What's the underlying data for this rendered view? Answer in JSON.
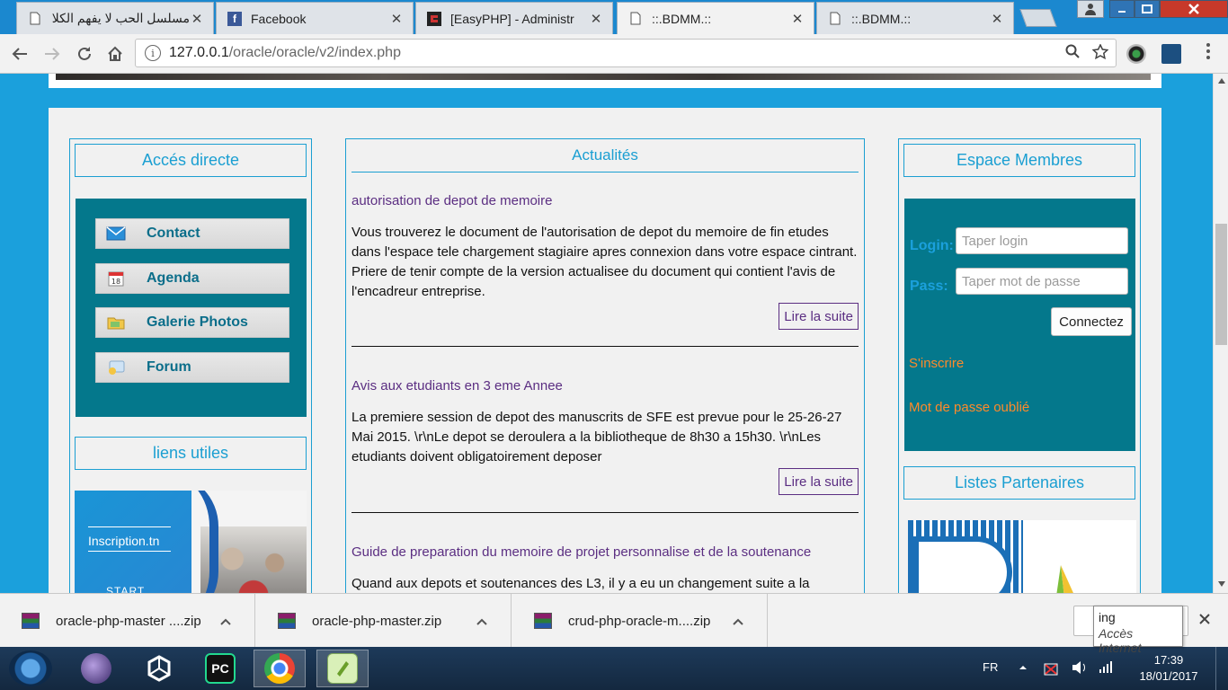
{
  "browser": {
    "tabs": [
      {
        "title": "مسلسل الحب لا يفهم الكلام ال",
        "icon": "page-icon",
        "active": false
      },
      {
        "title": "Facebook",
        "icon": "facebook-icon",
        "active": false
      },
      {
        "title": "[EasyPHP] - Administr",
        "icon": "easyphp-icon",
        "active": false
      },
      {
        "title": "::.BDMM.::",
        "icon": "page-icon",
        "active": true
      },
      {
        "title": "::.BDMM.::",
        "icon": "page-icon",
        "active": false
      }
    ],
    "close_glyph": "✕",
    "url_host": "127.0.0.1",
    "url_path": "/oracle/oracle/v2/index.php"
  },
  "left": {
    "title": "Accés directe",
    "menu": [
      {
        "label": "Contact",
        "icon": "envelope-icon"
      },
      {
        "label": "Agenda",
        "icon": "calendar-icon"
      },
      {
        "label": "Galerie Photos",
        "icon": "folder-icon"
      },
      {
        "label": "Forum",
        "icon": "forum-icon"
      }
    ],
    "links_title": "liens utiles",
    "promo_text": "Inscription.tn",
    "promo_start": "START"
  },
  "news": {
    "title": "Actualités",
    "read_more": "Lire la suite",
    "items": [
      {
        "title": "autorisation de depot de memoire",
        "body": "Vous trouverez le document de l'autorisation de depot du memoire de fin etudes dans l'espace tele chargement stagiaire apres connexion dans votre espace cintrant. Priere de tenir compte de la version actualisee du document qui contient l'avis de l'encadreur entreprise."
      },
      {
        "title": "Avis aux etudiants en 3 eme Annee",
        "body": "La premiere session de depot des manuscrits de SFE est prevue pour le 25-26-27 Mai 2015. \\r\\nLe depot se deroulera a la bibliotheque de 8h30 a 15h30. \\r\\nLes etudiants doivent obligatoirement deposer"
      },
      {
        "title": "Guide de preparation du memoire de projet personnalise et de la soutenance",
        "body": "Quand aux depots et soutenances des L3, il y a eu un changement suite a la"
      }
    ]
  },
  "members": {
    "title": "Espace Membres",
    "login_label": "Login:",
    "login_placeholder": "Taper login",
    "pass_label": "Pass:",
    "pass_placeholder": "Taper mot de passe",
    "connect": "Connectez",
    "register": "S'inscrire",
    "forgot": "Mot de passe oublié",
    "partners_title": "Listes Partenaires"
  },
  "downloads": {
    "items": [
      {
        "name": "oracle-php-master ....zip"
      },
      {
        "name": "oracle-php-master.zip"
      },
      {
        "name": "crud-php-oracle-m....zip"
      }
    ],
    "tooltip_line1": "ing",
    "tooltip_line2": "Accès Internet"
  },
  "taskbar": {
    "lang": "FR",
    "time": "17:39",
    "date": "18/01/2017",
    "pycharm_label": "PC"
  },
  "colors": {
    "accent": "#1ba0dc",
    "teal_panel": "#04788c",
    "news_title": "#5b2e82",
    "orange_link": "#ff8a2a"
  }
}
